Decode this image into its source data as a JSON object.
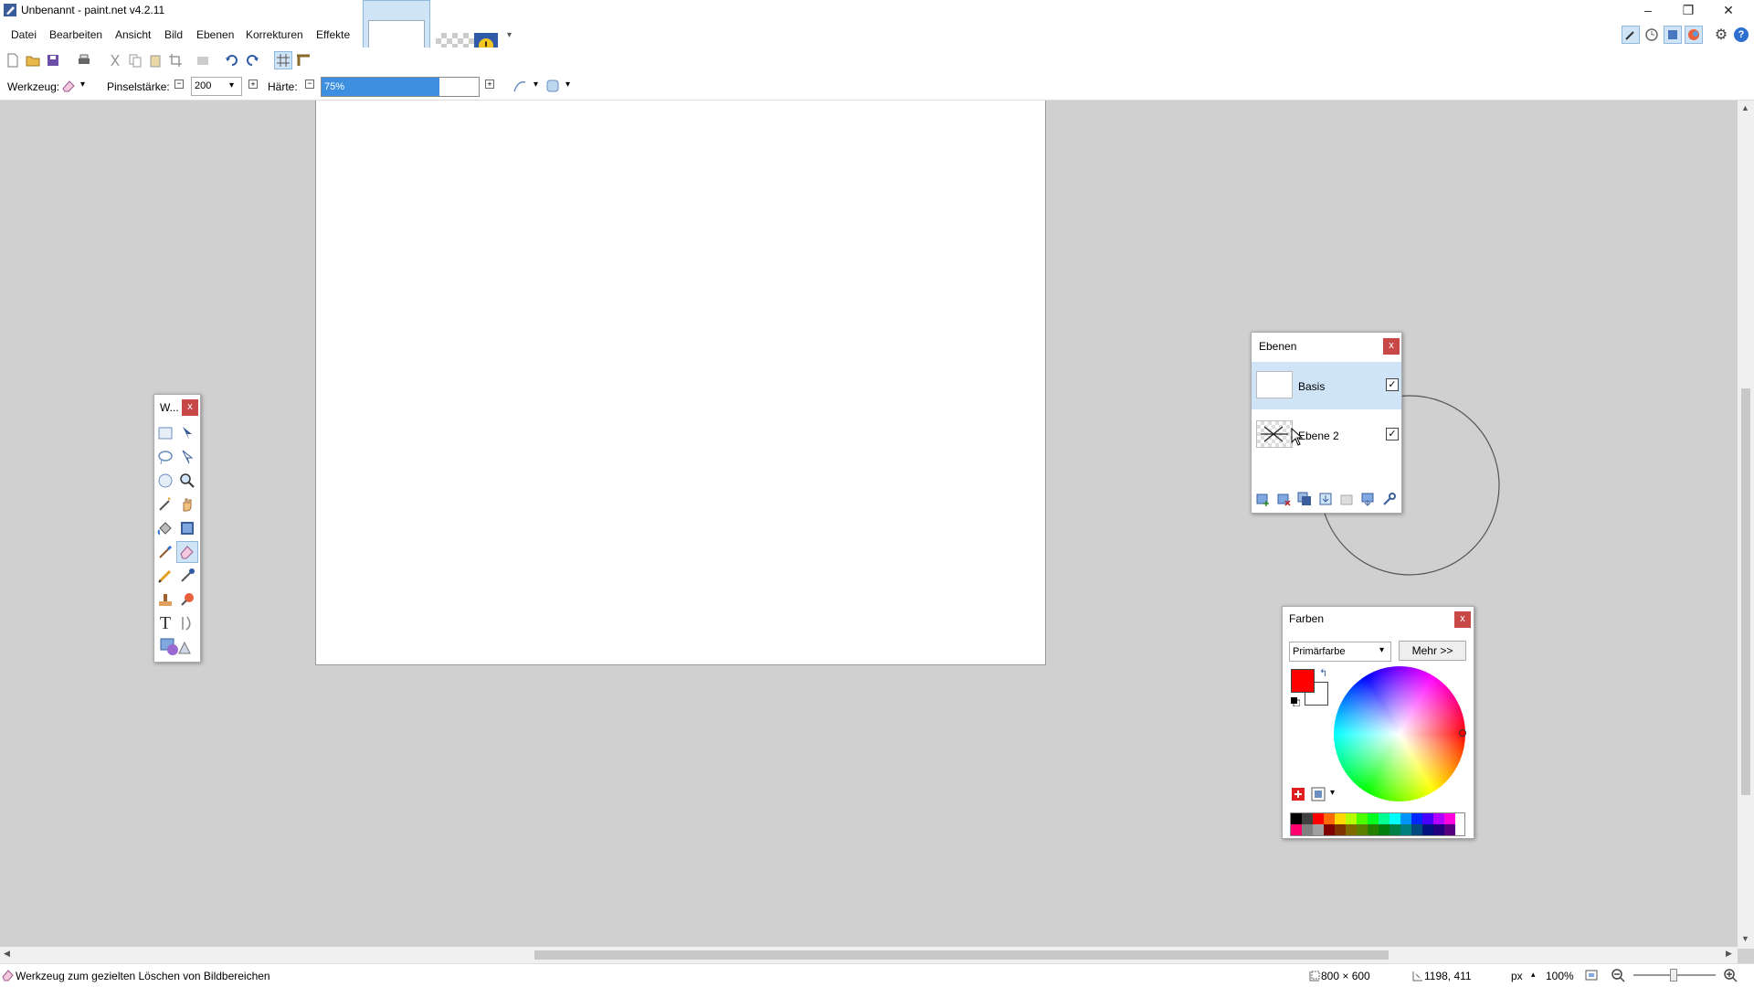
{
  "window": {
    "title": "Unbenannt - paint.net v4.2.11",
    "minimize_glyph": "–",
    "restore_glyph": "❐",
    "close_glyph": "✕"
  },
  "menu": [
    {
      "label": "Datei"
    },
    {
      "label": "Bearbeiten"
    },
    {
      "label": "Ansicht"
    },
    {
      "label": "Bild"
    },
    {
      "label": "Ebenen"
    },
    {
      "label": "Korrekturen"
    },
    {
      "label": "Effekte"
    }
  ],
  "options": {
    "tool_label": "Werkzeug:",
    "brush_size_label": "Pinselstärke:",
    "brush_size_value": "200",
    "hardness_label": "Härte:",
    "hardness_text": "75%",
    "hardness_value": 0.75
  },
  "tools_window": {
    "title": "W...",
    "close": "x"
  },
  "layers_window": {
    "title": "Ebenen",
    "close": "x",
    "layers": [
      {
        "name": "Basis",
        "visible": true,
        "selected": true
      },
      {
        "name": "Ebene 2",
        "visible": true,
        "selected": false
      }
    ],
    "check": "✓"
  },
  "colors_window": {
    "title": "Farben",
    "close": "x",
    "mode": "Primärfarbe",
    "more_label": "Mehr >>",
    "primary_color": "#ff0000",
    "secondary_color": "#ffffff",
    "palette_top": [
      "#000000",
      "#404040",
      "#ff0000",
      "#ff6a00",
      "#ffd800",
      "#b6ff00",
      "#4cff00",
      "#00ff21",
      "#00ff90",
      "#00ffff",
      "#0094ff",
      "#0026ff",
      "#4800ff",
      "#b200ff",
      "#ff00dc",
      "#ff006e"
    ],
    "palette_bottom": [
      "#808080",
      "#a0a0a0",
      "#7f0000",
      "#7f3300",
      "#7f6a00",
      "#5b7f00",
      "#267f00",
      "#007f0e",
      "#007f46",
      "#007f7f",
      "#004a7f",
      "#00137f",
      "#21007f",
      "#57007f",
      "#7f006e",
      "#7f0037"
    ]
  },
  "status": {
    "hint": "Werkzeug zum gezielten Löschen von Bildbereichen",
    "image_size": "800 × 600",
    "cursor_pos": "1198, 411",
    "unit": "px",
    "zoom": "100%"
  },
  "colors": {
    "accent": "#3d8fe0",
    "selection": "#cfe4f7",
    "close_red": "#c84848"
  }
}
